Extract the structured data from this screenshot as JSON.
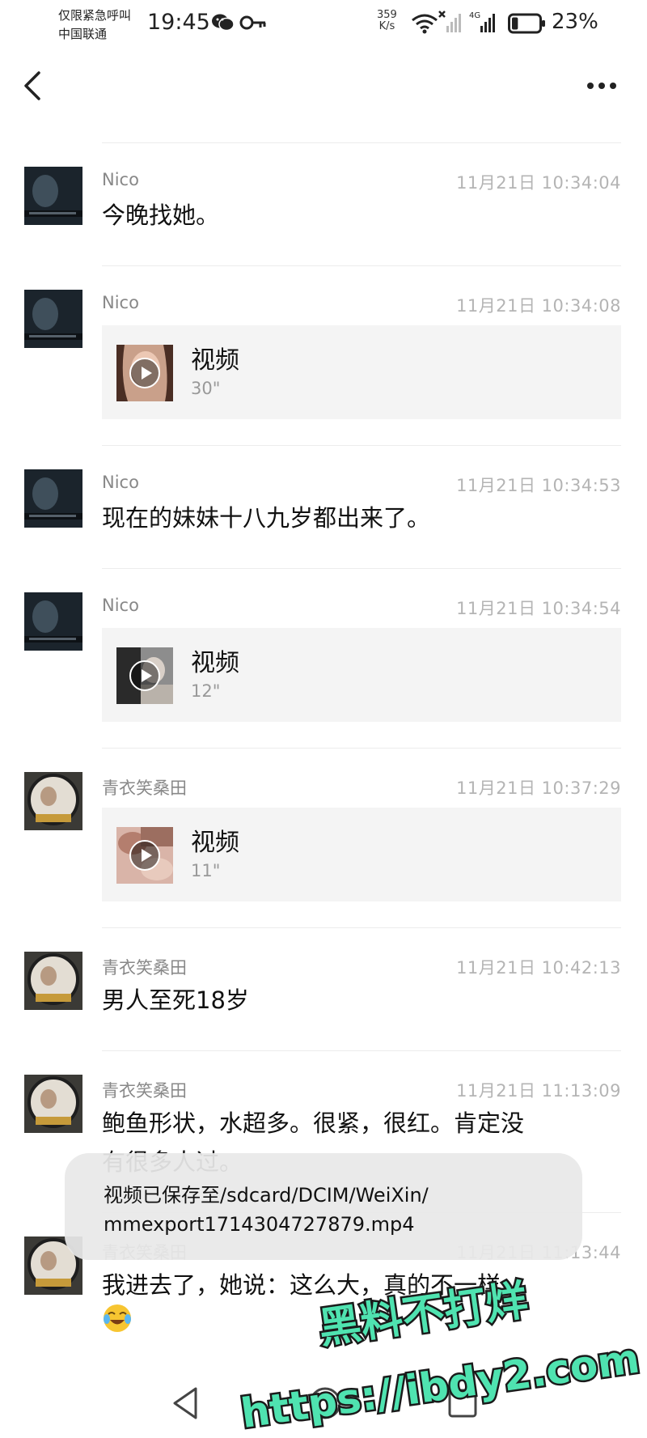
{
  "status_bar": {
    "carrier_line1": "仅限紧急呼叫",
    "carrier_line2": "中国联通",
    "time": "19:45",
    "net_speed_value": "359",
    "net_speed_unit": "K/s",
    "network_type": "4G",
    "battery_percent": "23%",
    "battery_level": 0.23,
    "icons": [
      "wechat-icon",
      "key-icon",
      "wifi-icon",
      "signal-no-sim-icon",
      "signal-4g-icon",
      "battery-icon"
    ]
  },
  "nav": {
    "icons": [
      "back-arrow-icon",
      "more-icon"
    ]
  },
  "records": [
    {
      "sender": "Nico",
      "time": "11月21日 10:34:04",
      "type": "text",
      "text": "今晚找她。"
    },
    {
      "sender": "Nico",
      "time": "11月21日 10:34:08",
      "type": "video",
      "label": "视频",
      "duration": "30\""
    },
    {
      "sender": "Nico",
      "time": "11月21日 10:34:53",
      "type": "text",
      "text": "现在的妹妹十八九岁都出来了。"
    },
    {
      "sender": "Nico",
      "time": "11月21日 10:34:54",
      "type": "video",
      "label": "视频",
      "duration": "12\""
    },
    {
      "sender": "青衣笑桑田",
      "time": "11月21日 10:37:29",
      "type": "video",
      "label": "视频",
      "duration": "11\""
    },
    {
      "sender": "青衣笑桑田",
      "time": "11月21日 10:42:13",
      "type": "text",
      "text": "男人至死18岁"
    },
    {
      "sender": "青衣笑桑田",
      "time": "11月21日 11:13:09",
      "type": "text",
      "text_line1": "鲍鱼形状，水超多。很紧，很红。肯定没",
      "text_line2": "有很多人过。"
    },
    {
      "sender": "青衣笑桑田",
      "time": "11月21日 11:13:44",
      "type": "text",
      "text": "我进去了，她说：这么大，真的不一样…"
    }
  ],
  "toast": {
    "line1": "视频已保存至/sdcard/DCIM/WeiXin/",
    "line2": "mmexport1714304727879.mp4"
  },
  "watermark": {
    "line1": "黑料不打烊",
    "line2": "https://ibdy2.com",
    "color": "#4fe3b0"
  },
  "colors": {
    "card_bg": "#f4f4f4",
    "timestamp": "#b4b4b4",
    "sender": "#888888"
  }
}
